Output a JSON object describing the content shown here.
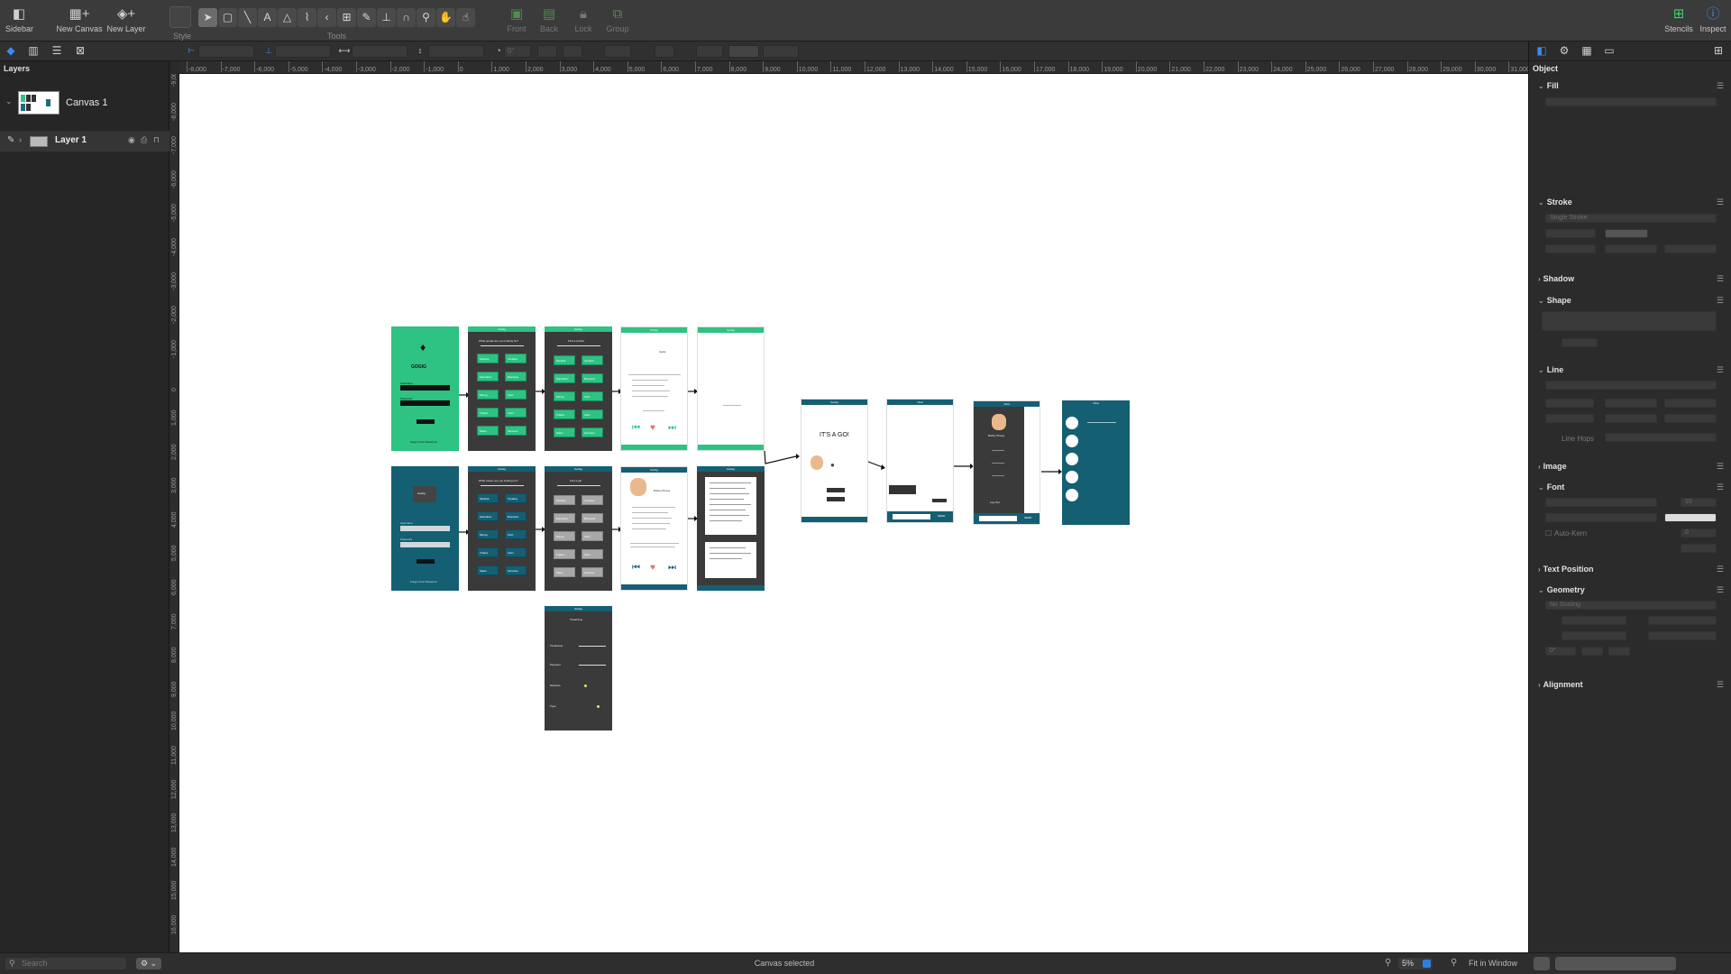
{
  "toolbar": {
    "sidebar_label": "Sidebar",
    "new_canvas_label": "New Canvas",
    "new_layer_label": "New Layer",
    "style_label": "Style",
    "tools_label": "Tools",
    "front_label": "Front",
    "back_label": "Back",
    "lock_label": "Lock",
    "group_label": "Group",
    "stencils_label": "Stencils",
    "inspect_label": "Inspect",
    "tool_icons": [
      "select-arrow-icon",
      "shape-icon",
      "line-icon",
      "text-icon",
      "pen-icon",
      "bezier-icon",
      "diagram-icon",
      "point-icon",
      "brush-icon",
      "stamp-icon",
      "magnet-icon",
      "zoom-icon",
      "hand-icon",
      "rotate-icon",
      "browse-icon"
    ]
  },
  "secondbar": {
    "x_field": "",
    "y_field": "",
    "w_field": "",
    "h_field": "",
    "rotation_field": "0°"
  },
  "sidebar": {
    "title": "Layers",
    "canvas_label": "Canvas 1",
    "layer_label": "Layer 1"
  },
  "ruler": {
    "h_ticks": [
      "-8,000",
      "-7,000",
      "-6,000",
      "-5,000",
      "-4,000",
      "-3,000",
      "-2,000",
      "-1,000",
      "0",
      "1,000",
      "2,000",
      "3,000",
      "4,000",
      "5,000",
      "6,000",
      "7,000",
      "8,000",
      "9,000",
      "10,000",
      "11,000",
      "12,000",
      "13,000",
      "14,000",
      "15,000",
      "16,000",
      "17,000",
      "18,000",
      "19,000",
      "20,000",
      "21,000",
      "22,000",
      "23,000",
      "24,000",
      "25,000",
      "26,000",
      "27,000",
      "28,000",
      "29,000",
      "30,000",
      "31,000"
    ],
    "v_ticks": [
      "-9,000",
      "-8,000",
      "-7,000",
      "-6,000",
      "-5,000",
      "-4,000",
      "-3,000",
      "-2,000",
      "-1,000",
      "0",
      "1,000",
      "2,000",
      "3,000",
      "4,000",
      "5,000",
      "6,000",
      "7,000",
      "8,000",
      "9,000",
      "10,000",
      "11,000",
      "12,000",
      "13,000",
      "14,000",
      "15,000",
      "16,000"
    ]
  },
  "canvas": {
    "screens": {
      "gogig_logo": "GOGIG",
      "gogig_alt": "GoGig",
      "its_a_go": "IT'S A GO!",
      "header_gogig": "GoGig",
      "header_chat": "Chat",
      "find_worker": "Find a worker",
      "find_job": "Find a job",
      "sign_in": "Sign In",
      "username": "Username",
      "password": "Password",
      "forgot": "Forgot Your Password",
      "what_people": "What people are you looking for?",
      "what_career": "What career are you looking for?",
      "apple": "Apple",
      "bobby": "Bobby Phung",
      "timeframe": "Timeframe",
      "payment": "Payment",
      "distance": "Distance",
      "type": "Type",
      "send": "SEND",
      "log_out": "Log Out",
      "discover": "Discover",
      "continue": "Continue",
      "grid_labels": [
        "Medical",
        "Creative",
        "Education",
        "Business",
        "Money",
        "Tech",
        "Trades",
        "Farm",
        "Sales",
        "Services"
      ]
    }
  },
  "inspector": {
    "header": "Object",
    "fill": "Fill",
    "stroke": "Stroke",
    "stroke_type": "Single Stroke",
    "shadow": "Shadow",
    "shape": "Shape",
    "line": "Line",
    "line_hops": "Line Hops",
    "image": "Image",
    "font": "Font",
    "font_size": "10",
    "auto_kern": "Auto-Kern",
    "kern_value": "0",
    "text_position": "Text Position",
    "geometry": "Geometry",
    "scaling": "No Scaling",
    "geo_rotation": "0°",
    "alignment": "Alignment"
  },
  "statusbar": {
    "search_placeholder": "Search",
    "status_text": "Canvas selected",
    "zoom_value": "5%",
    "fit_label": "Fit in Window"
  },
  "colors": {
    "green": "#2ec283",
    "teal": "#155f73",
    "dark": "#3a3a3a",
    "accent": "#3b8cf0"
  }
}
